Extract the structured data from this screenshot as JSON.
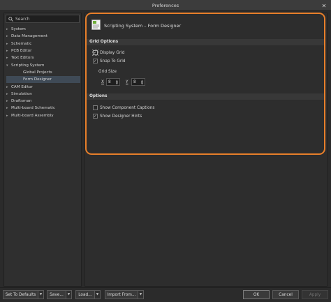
{
  "window": {
    "title": "Preferences",
    "close_glyph": "✕"
  },
  "search": {
    "placeholder": "Search"
  },
  "tree": [
    {
      "label": "System",
      "expanded": false
    },
    {
      "label": "Data Management",
      "expanded": false
    },
    {
      "label": "Schematic",
      "expanded": false
    },
    {
      "label": "PCB Editor",
      "expanded": false
    },
    {
      "label": "Text Editors",
      "expanded": false
    },
    {
      "label": "Scripting System",
      "expanded": true
    },
    {
      "label": "Global Projects",
      "child": true
    },
    {
      "label": "Form Designer",
      "child": true,
      "selected": true
    },
    {
      "label": "CAM Editor",
      "expanded": false
    },
    {
      "label": "Simulation",
      "expanded": false
    },
    {
      "label": "Draftsman",
      "expanded": false
    },
    {
      "label": "Multi-board Schematic",
      "expanded": false
    },
    {
      "label": "Multi-board Assembly",
      "expanded": false
    }
  ],
  "page": {
    "title": "Scripting System – Form Designer",
    "icon": "form-designer-page-icon"
  },
  "grid_options": {
    "header": "Grid Options",
    "display_grid": {
      "label": "Display Grid",
      "checked": true
    },
    "snap_to_grid": {
      "label": "Snap To Grid",
      "checked": true
    },
    "grid_size_label": "Grid Size",
    "x_label": "X",
    "x_value": "8",
    "y_label": "Y",
    "y_value": "8"
  },
  "options": {
    "header": "Options",
    "show_component_captions": {
      "label": "Show Component Captions",
      "checked": false
    },
    "show_designer_hints": {
      "label": "Show Designer Hints",
      "checked": true
    }
  },
  "footer": {
    "set_to_defaults": "Set To Defaults",
    "save": "Save...",
    "load": "Load...",
    "import_from": "Import From...",
    "ok": "OK",
    "cancel": "Cancel",
    "apply": "Apply"
  },
  "colors": {
    "highlight": "#e87f2a",
    "selected_row": "#3f4a56",
    "background": "#2b2b2b"
  }
}
